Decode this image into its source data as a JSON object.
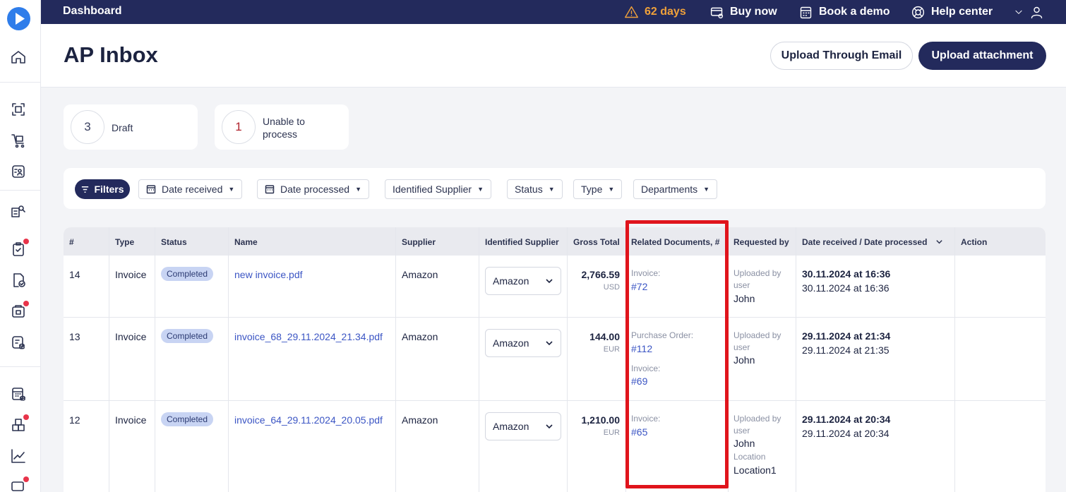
{
  "topbar": {
    "breadcrumb": "Dashboard",
    "trial_days": "62 days",
    "buy_now": "Buy now",
    "book_demo": "Book a demo",
    "help_center": "Help center"
  },
  "header": {
    "title": "AP Inbox",
    "upload_email": "Upload Through Email",
    "upload_attachment": "Upload attachment"
  },
  "stats": [
    {
      "count": "3",
      "label": "Draft"
    },
    {
      "count": "1",
      "label": "Unable to process"
    }
  ],
  "filters": {
    "filters_label": "Filters",
    "chips": [
      "Date received",
      "Date processed",
      "Identified Supplier",
      "Status",
      "Type",
      "Departments"
    ]
  },
  "table": {
    "columns": [
      "#",
      "Type",
      "Status",
      "Name",
      "Supplier",
      "Identified Supplier",
      "Gross Total",
      "Related Documents, #",
      "Requested by",
      "Date received / Date processed",
      "Action"
    ],
    "rows": [
      {
        "id": "14",
        "type": "Invoice",
        "status": "Completed",
        "name": "new invoice.pdf",
        "supplier": "Amazon",
        "identified_supplier": "Amazon",
        "amount": "2,766.59",
        "currency": "USD",
        "related": [
          {
            "label": "Invoice:",
            "ref": "#72"
          }
        ],
        "requested_label_1": "Uploaded by",
        "requested_label_2": "user",
        "requested_name": "John",
        "date_received": "30.11.2024 at 16:36",
        "date_processed": "30.11.2024 at 16:36"
      },
      {
        "id": "13",
        "type": "Invoice",
        "status": "Completed",
        "name": "invoice_68_29.11.2024_21.34.pdf",
        "supplier": "Amazon",
        "identified_supplier": "Amazon",
        "amount": "144.00",
        "currency": "EUR",
        "related": [
          {
            "label": "Purchase Order:",
            "ref": "#112"
          },
          {
            "label": "Invoice:",
            "ref": "#69"
          }
        ],
        "requested_label_1": "Uploaded by",
        "requested_label_2": "user",
        "requested_name": "John",
        "date_received": "29.11.2024 at 21:34",
        "date_processed": "29.11.2024 at 21:35"
      },
      {
        "id": "12",
        "type": "Invoice",
        "status": "Completed",
        "name": "invoice_64_29.11.2024_20.05.pdf",
        "supplier": "Amazon",
        "identified_supplier": "Amazon",
        "amount": "1,210.00",
        "currency": "EUR",
        "related": [
          {
            "label": "Invoice:",
            "ref": "#65"
          }
        ],
        "requested_label_1": "Uploaded by",
        "requested_label_2": "user",
        "requested_name": "John",
        "location_label": "Location",
        "location_value": "Location1",
        "date_received": "29.11.2024 at 20:34",
        "date_processed": "29.11.2024 at 20:34"
      }
    ]
  },
  "colors": {
    "navy": "#232a5c",
    "accent_blue": "#2f7dea",
    "link": "#3b55c4",
    "warning": "#f0a13a",
    "highlight_red": "#e0141c",
    "badge_bg": "#c8d4f3"
  }
}
